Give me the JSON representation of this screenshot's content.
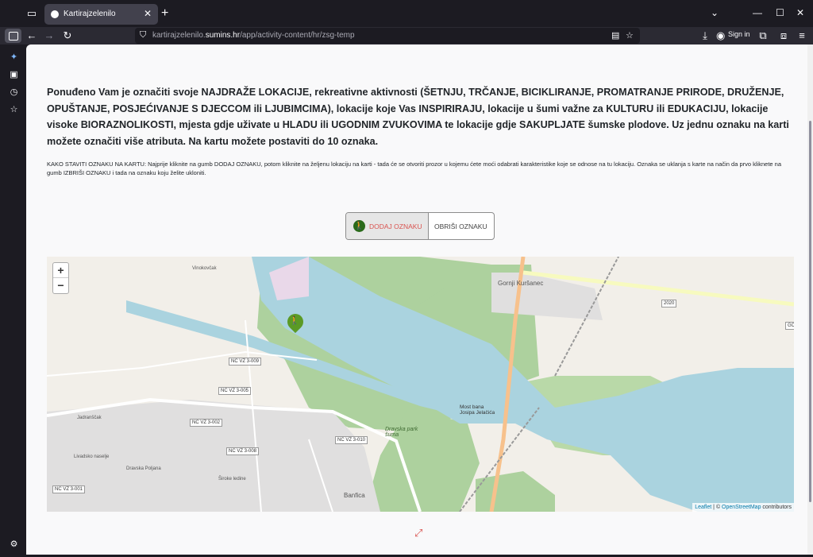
{
  "browser": {
    "tab_title": "Kartirajzelenilo",
    "url_prefix": "kartirajzelenilo.",
    "url_domain": "sumins.hr",
    "url_path": "/app/activity-content/hr/zsg-temp",
    "sign_in": "Sign in"
  },
  "content": {
    "intro": "Ponuđeno Vam je označiti svoje NAJDRAŽE LOKACIJE, rekreativne aktivnosti (ŠETNJU, TRČANJE, BICIKLIRANJE, PROMATRANJE PRIRODE, DRUŽENJE, OPUŠTANJE, POSJEĆIVANJE S DJECCOM ili LJUBIMCIMA), lokacije koje Vas INSPIRIRAJU, lokacije u šumi važne za KULTURU ili EDUKACIJU, lokacije visoke BIORAZNOLIKOSTI, mjesta gdje uživate u HLADU ili UGODNIM ZVUKOVIMA te lokacije gdje SAKUPLJATE šumske plodove. Uz jednu oznaku na karti možete označiti više atributa. Na kartu možete postaviti do 10 oznaka.",
    "how_to": "KAKO STAVITI OZNAKU NA KARTU: Najprije kliknite na gumb DODAJ OZNAKU, potom kliknite na željenu lokaciju na karti - tada će se otvoriti prozor u kojemu ćete moći odabrati karakteristike koje se odnose na tu lokaciju. Oznaka se uklanja s karte na način da prvo kliknete na gumb IZBRIŠI OZNAKU i tada na oznaku koju želite ukloniti.",
    "add_button": "DODAJ OZNAKU",
    "delete_button": "OBRIŠI OZNAKU"
  },
  "map": {
    "zoom_in": "+",
    "zoom_out": "−",
    "attribution_leaflet": "Leaflet",
    "attribution_sep": " | © ",
    "attribution_osm": "OpenStreetMap",
    "attribution_tail": " contributors",
    "labels": {
      "vinokovcak": "Vinokovčak",
      "gornji_kursanec": "Gornji Kuršanec",
      "jadranscak": "Jadranščak",
      "livadsko": "Livadsko naselje",
      "dravska_poljana": "Dravska Poljana",
      "siroke_ledine": "Široke ledine",
      "banfica": "Banfica",
      "dravska_park": "Dravska park šuma",
      "most": "Most bana Josipa Jelačića",
      "road_2020": "2020",
      "road_g": "GC"
    },
    "shields": [
      "NC VZ 3-009",
      "NC VZ 3-005",
      "NC VZ 3-002",
      "NC VZ 3-008",
      "NC VZ 3-010",
      "NC VZ 3-001"
    ]
  },
  "colors": {
    "forest": "#add19e",
    "river": "#aad3df",
    "road_major": "#f7c18c",
    "marker": "#5b9a25",
    "accent_red": "#d9534f"
  },
  "icons": {
    "marker": "walking-person-icon",
    "expand": "expand-arrows-icon"
  }
}
